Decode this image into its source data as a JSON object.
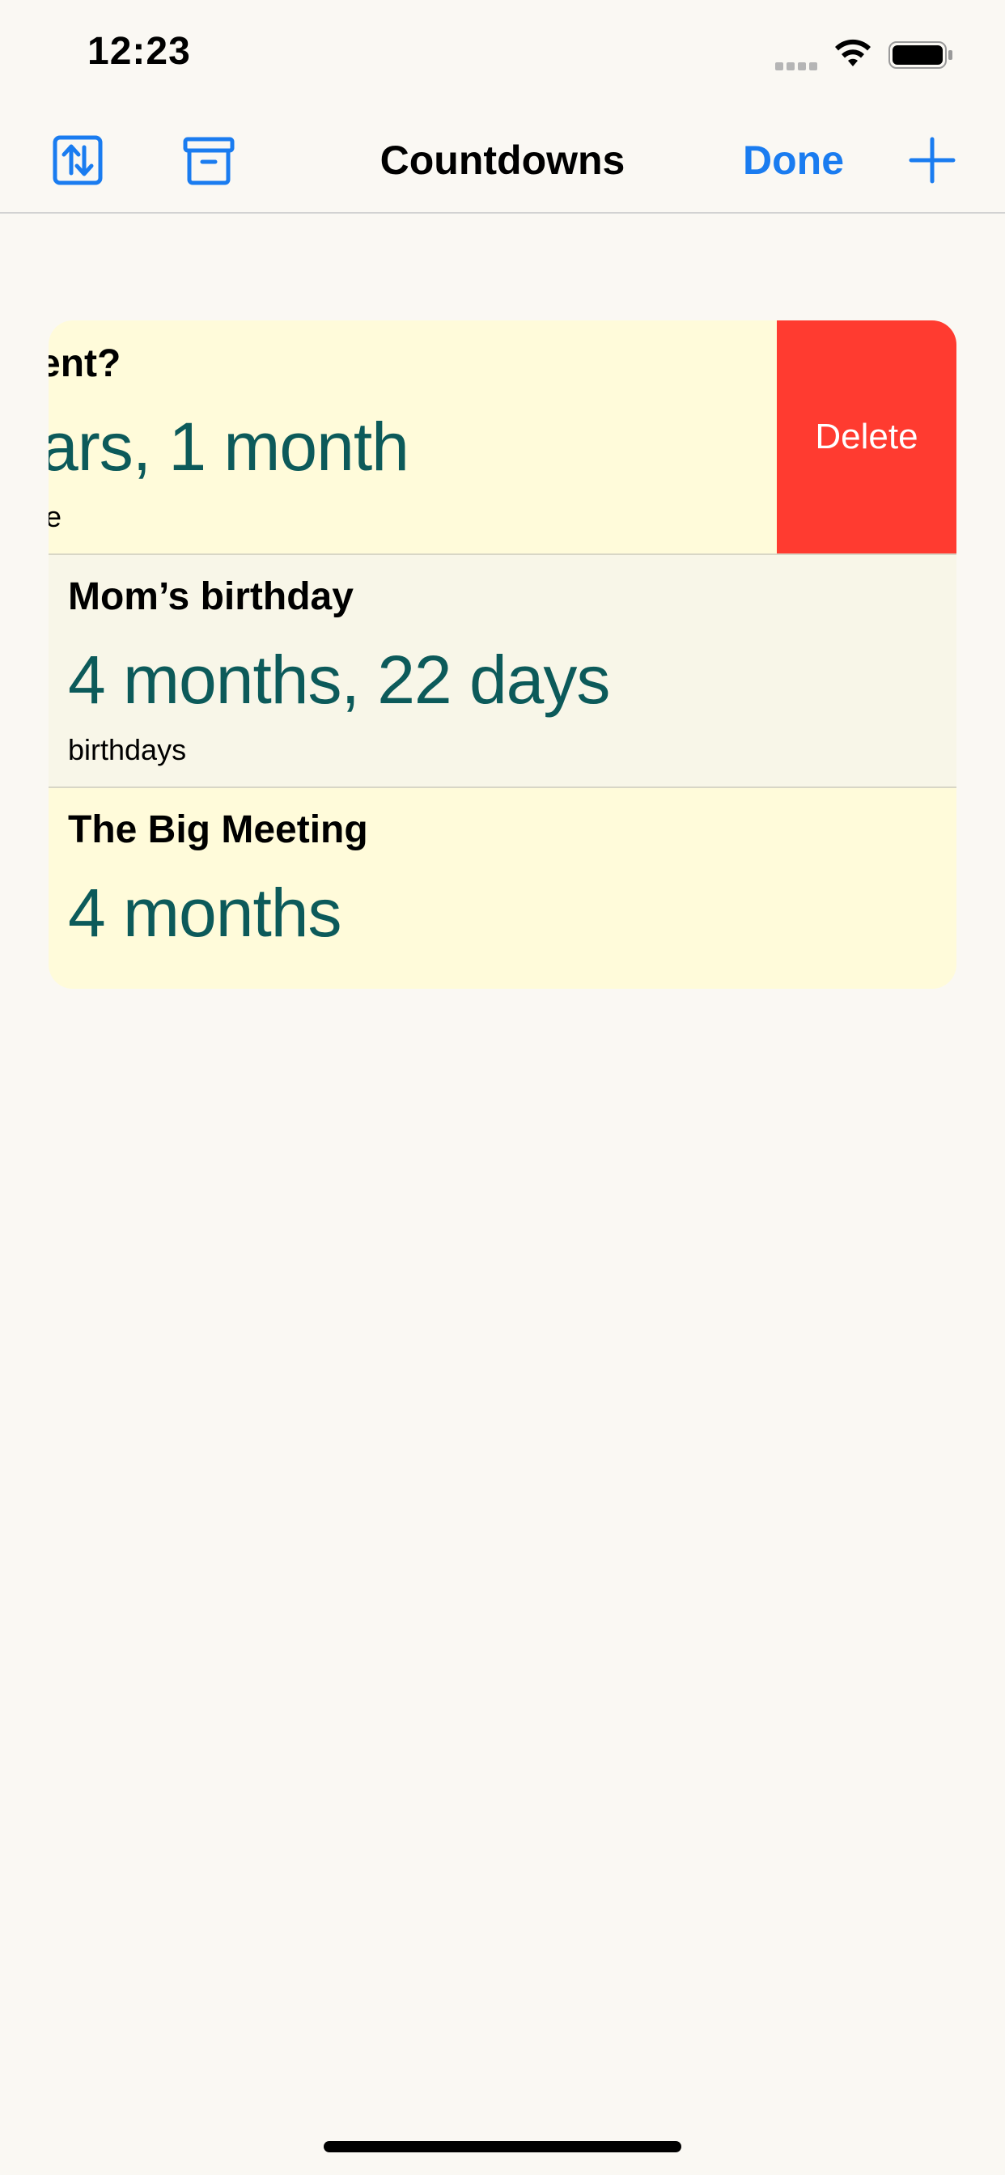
{
  "status_bar": {
    "time": "12:23"
  },
  "nav": {
    "title": "Countdowns",
    "done_label": "Done",
    "accent_color": "#1a7cf0",
    "icons": [
      "sort-icon",
      "archive-icon",
      "plus-icon"
    ]
  },
  "rows": [
    {
      "title": "ent?",
      "value": "ars, 1 month",
      "subtitle": "e",
      "swiped": true,
      "background": "#fffbda"
    },
    {
      "title": "Mom’s birthday",
      "value": "4 months, 22 days",
      "subtitle": "birthdays",
      "background": "#f8f6e8"
    },
    {
      "title": "The Big Meeting",
      "value": "4 months",
      "background": "#fffbda"
    }
  ],
  "swipe_action": {
    "label": "Delete",
    "color": "#ff3b30"
  },
  "value_color": "#0c5a5a"
}
